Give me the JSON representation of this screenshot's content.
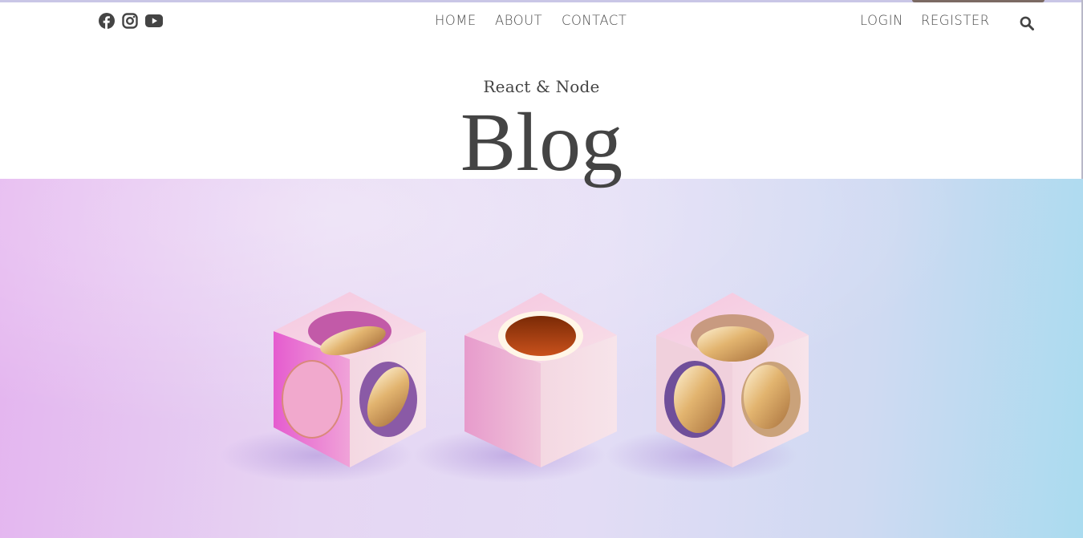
{
  "social": {
    "icons": [
      "facebook-icon",
      "instagram-icon",
      "youtube-icon"
    ]
  },
  "nav": {
    "left_items": [
      {
        "label": "HOME"
      },
      {
        "label": "ABOUT"
      },
      {
        "label": "CONTACT"
      }
    ],
    "right_items": [
      {
        "label": "LOGIN"
      },
      {
        "label": "REGISTER"
      }
    ],
    "search_icon": "search-icon"
  },
  "header": {
    "subtitle": "React & Node",
    "title": "Blog"
  },
  "colors": {
    "text": "#444444",
    "background": "#ffffff",
    "hero_gradient_left": "#e4b4ef",
    "hero_gradient_right": "#aadbef"
  }
}
